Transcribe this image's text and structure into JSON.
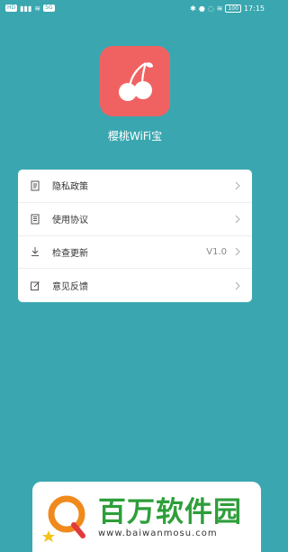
{
  "status": {
    "time": "17:15",
    "battery": "100",
    "left_chip": "HD",
    "left_chip2": "5G"
  },
  "app": {
    "name": "樱桃WiFi宝",
    "icon": "cherry-icon"
  },
  "menu": [
    {
      "label": "隐私政策",
      "icon": "document-icon",
      "value": ""
    },
    {
      "label": "使用协议",
      "icon": "list-document-icon",
      "value": ""
    },
    {
      "label": "检查更新",
      "icon": "download-icon",
      "value": "V1.0"
    },
    {
      "label": "意见反馈",
      "icon": "edit-icon",
      "value": ""
    }
  ],
  "watermark": {
    "title": "百万软件园",
    "url": "www.baiwanmosu.com"
  },
  "colors": {
    "background": "#3aa7b0",
    "app_icon": "#f06262",
    "watermark_green": "#2e9e3a"
  }
}
